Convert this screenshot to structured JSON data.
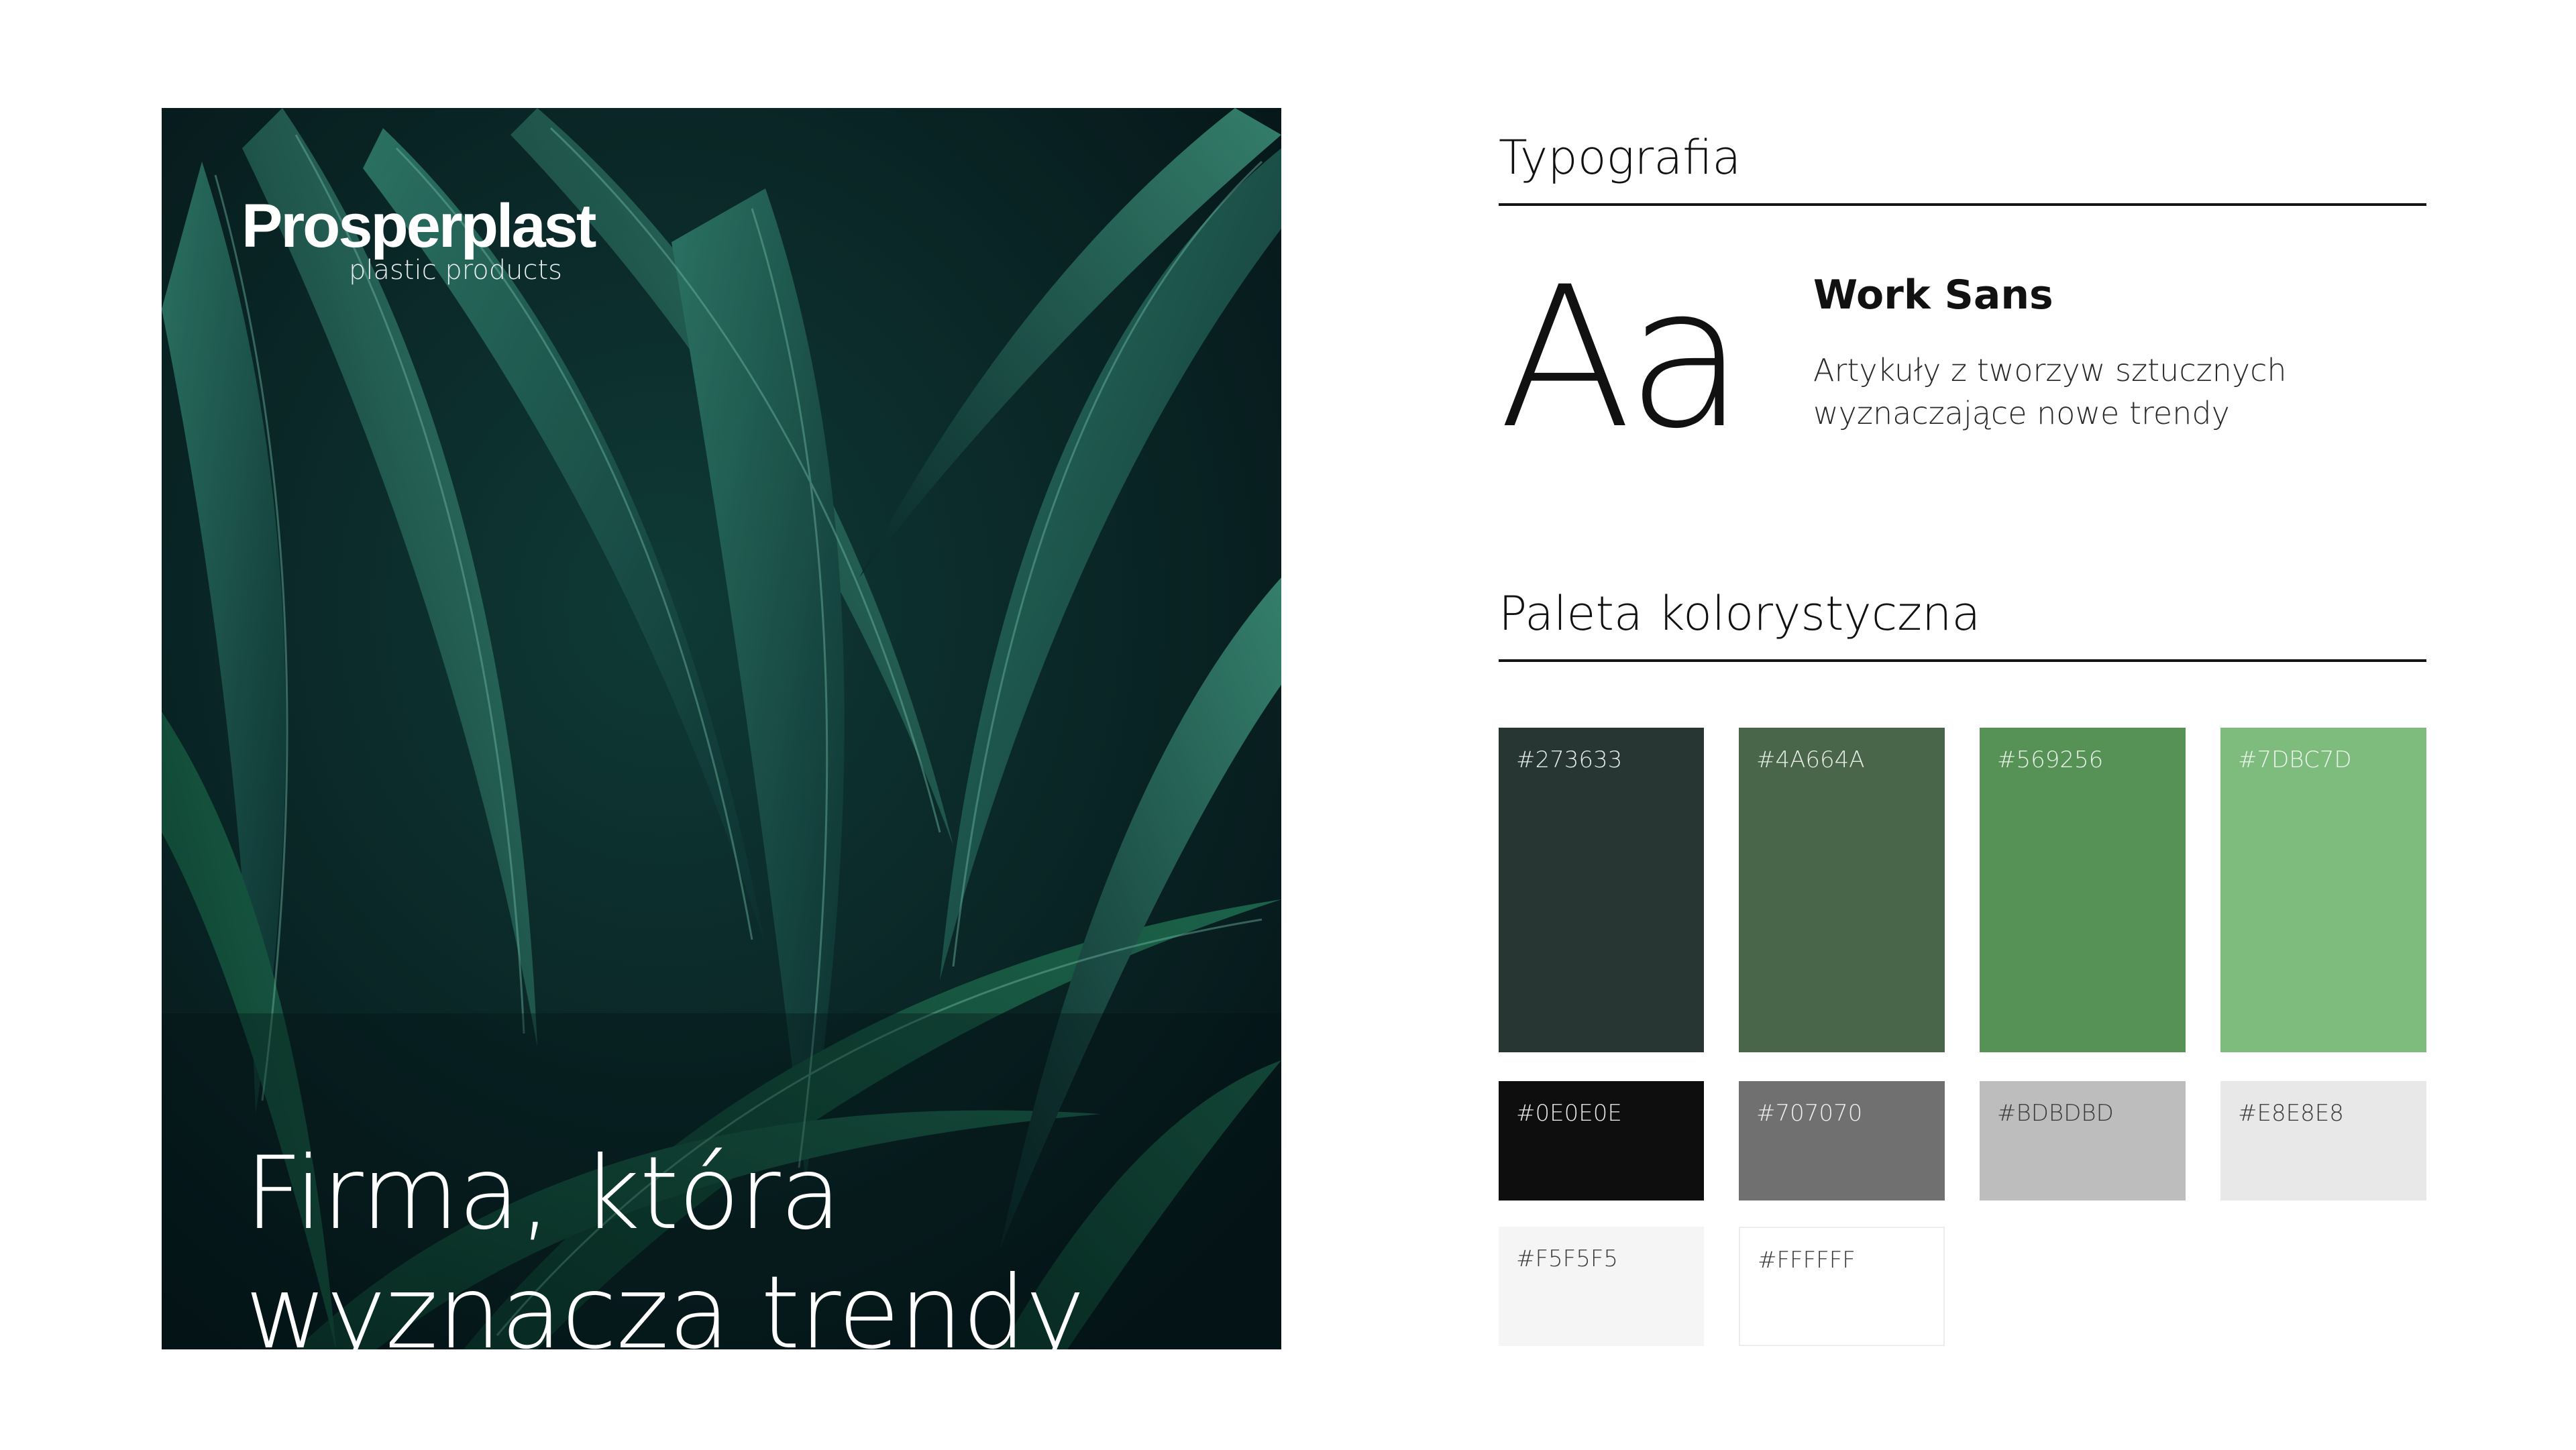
{
  "hero": {
    "logo_name": "Prosperplast",
    "logo_tagline": "plastic products",
    "headline_line1": "Firma, która",
    "headline_line2": "wyznacza trendy"
  },
  "typography": {
    "title": "Typografia",
    "specimen": "Aa",
    "font_name": "Work Sans",
    "description_line1": "Artykuły z tworzyw sztucznych",
    "description_line2": "wyznaczające nowe trendy"
  },
  "palette": {
    "title": "Paleta kolorystyczna",
    "swatches": [
      {
        "code": "#273633",
        "color": "#273633",
        "text_color": "#e6ecea"
      },
      {
        "code": "#4A664A",
        "color": "#4A664A",
        "text_color": "#e6ece6"
      },
      {
        "code": "#569256",
        "color": "#569256",
        "text_color": "#e8f2e8"
      },
      {
        "code": "#7DBC7D",
        "color": "#7DBC7D",
        "text_color": "#eef8ee"
      },
      {
        "code": "#0E0E0E",
        "color": "#0E0E0E",
        "text_color": "#e8e8e8"
      },
      {
        "code": "#707070",
        "color": "#707070",
        "text_color": "#eeeeee"
      },
      {
        "code": "#BDBDBD",
        "color": "#BDBDBD",
        "text_color": "#3a3a3a"
      },
      {
        "code": "#E8E8E8",
        "color": "#E8E8E8",
        "text_color": "#3a3a3a"
      },
      {
        "code": "#F5F5F5",
        "color": "#F5F5F5",
        "text_color": "#3a3a3a"
      },
      {
        "code": "#FFFFFF",
        "color": "#FFFFFF",
        "text_color": "#3a3a3a"
      }
    ]
  }
}
